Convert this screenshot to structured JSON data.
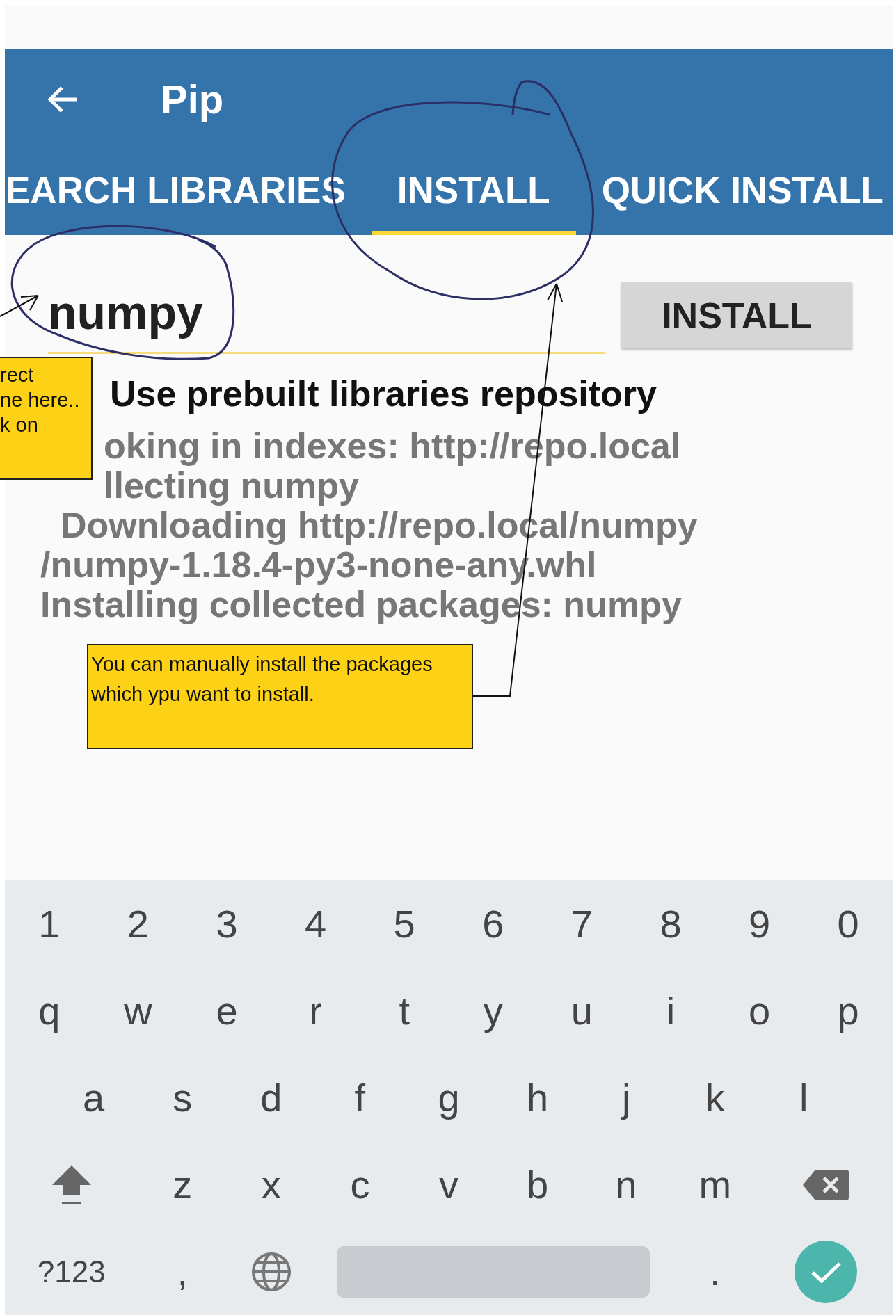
{
  "app_bar": {
    "title": "Pip"
  },
  "tabs": [
    {
      "label": "EARCH LIBRARIES",
      "selected": false
    },
    {
      "label": "INSTALL",
      "selected": true
    },
    {
      "label": "QUICK INSTALL",
      "selected": false
    }
  ],
  "package_field": {
    "value": "numpy"
  },
  "install_button": "INSTALL",
  "option": {
    "label": "Use prebuilt libraries repository"
  },
  "log_lines": [
    {
      "kind": "partly_hidden",
      "text": "oking in indexes: http://repo.local"
    },
    {
      "kind": "partly_hidden",
      "text": "llecting numpy"
    },
    {
      "kind": "plain",
      "text": "  Downloading http://repo.local/numpy"
    },
    {
      "kind": "plain",
      "text": "/numpy‑1.18.4‑py3‑none‑any.whl"
    },
    {
      "kind": "plain",
      "text": "Installing collected packages: numpy"
    }
  ],
  "keyboard": {
    "rows": [
      [
        {
          "kind": "char",
          "label": "1"
        },
        {
          "kind": "char",
          "label": "2"
        },
        {
          "kind": "char",
          "label": "3"
        },
        {
          "kind": "char",
          "label": "4"
        },
        {
          "kind": "char",
          "label": "5"
        },
        {
          "kind": "char",
          "label": "6"
        },
        {
          "kind": "char",
          "label": "7"
        },
        {
          "kind": "char",
          "label": "8"
        },
        {
          "kind": "char",
          "label": "9"
        },
        {
          "kind": "char",
          "label": "0"
        }
      ],
      [
        {
          "kind": "char",
          "label": "q"
        },
        {
          "kind": "char",
          "label": "w"
        },
        {
          "kind": "char",
          "label": "e"
        },
        {
          "kind": "char",
          "label": "r"
        },
        {
          "kind": "char",
          "label": "t"
        },
        {
          "kind": "char",
          "label": "y"
        },
        {
          "kind": "char",
          "label": "u"
        },
        {
          "kind": "char",
          "label": "i"
        },
        {
          "kind": "char",
          "label": "o"
        },
        {
          "kind": "char",
          "label": "p"
        }
      ],
      [
        {
          "kind": "char",
          "label": "a"
        },
        {
          "kind": "char",
          "label": "s"
        },
        {
          "kind": "char",
          "label": "d"
        },
        {
          "kind": "char",
          "label": "f"
        },
        {
          "kind": "char",
          "label": "g"
        },
        {
          "kind": "char",
          "label": "h"
        },
        {
          "kind": "char",
          "label": "j"
        },
        {
          "kind": "char",
          "label": "k"
        },
        {
          "kind": "char",
          "label": "l"
        }
      ],
      [
        {
          "kind": "shift"
        },
        {
          "kind": "char",
          "label": "z"
        },
        {
          "kind": "char",
          "label": "x"
        },
        {
          "kind": "char",
          "label": "c"
        },
        {
          "kind": "char",
          "label": "v"
        },
        {
          "kind": "char",
          "label": "b"
        },
        {
          "kind": "char",
          "label": "n"
        },
        {
          "kind": "char",
          "label": "m"
        },
        {
          "kind": "backspace"
        }
      ],
      [
        {
          "kind": "symbols",
          "label": "?123"
        },
        {
          "kind": "char",
          "label": ","
        },
        {
          "kind": "globe"
        },
        {
          "kind": "space"
        },
        {
          "kind": "char",
          "label": "."
        },
        {
          "kind": "enter"
        }
      ]
    ]
  },
  "annotations": [
    {
      "kind": "note",
      "lines": [
        "rect",
        "ne here..",
        "k on"
      ]
    },
    {
      "kind": "callout",
      "text": "You can manually install the packages which ypu want to install."
    }
  ]
}
